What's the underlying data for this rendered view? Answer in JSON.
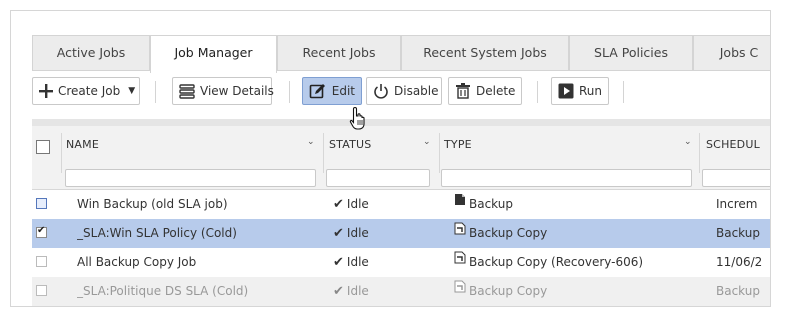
{
  "tabs": [
    {
      "label": "Active Jobs"
    },
    {
      "label": "Job Manager"
    },
    {
      "label": "Recent Jobs"
    },
    {
      "label": "Recent System Jobs"
    },
    {
      "label": "SLA Policies"
    },
    {
      "label": "Jobs C"
    }
  ],
  "toolbar": {
    "create_job": "Create Job",
    "view_details": "View Details",
    "edit": "Edit",
    "disable": "Disable",
    "delete": "Delete",
    "run": "Run"
  },
  "columns": {
    "name": "NAME",
    "status": "STATUS",
    "type": "TYPE",
    "schedule": "SCHEDUL"
  },
  "rows": [
    {
      "name": "Win Backup (old SLA job)",
      "status": "Idle",
      "type": "Backup",
      "schedule": "Increm"
    },
    {
      "name": "_SLA:Win SLA Policy (Cold)",
      "status": "Idle",
      "type": "Backup Copy",
      "schedule": "Backup"
    },
    {
      "name": "All Backup Copy Job",
      "status": "Idle",
      "type": "Backup Copy (Recovery-606)",
      "schedule": "11/06/2"
    },
    {
      "name": "_SLA:Politique DS SLA (Cold)",
      "status": "Idle",
      "type": "Backup Copy",
      "schedule": "Backup"
    }
  ],
  "colors": {
    "selected_row": "#b7cbeb",
    "edit_button": "#b7cbeb"
  }
}
